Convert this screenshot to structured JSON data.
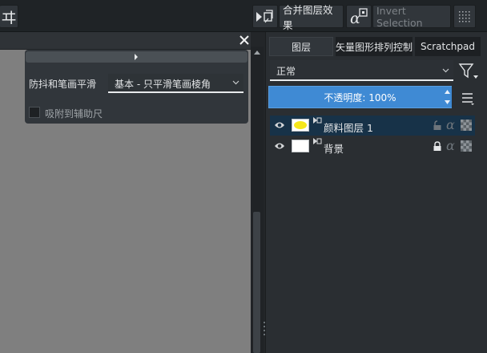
{
  "toolbar": {
    "merge_layer_effects_label": "合并图层效果",
    "invert_selection_label": "Invert Selection",
    "partial_glyph": "ヰ"
  },
  "tool_options": {
    "smoothing_label": "防抖和笔画平滑",
    "smoothing_value": "基本 - 只平滑笔画棱角",
    "snap_assistant_label": "吸附到辅助尺",
    "snap_assistant_checked": false
  },
  "layers_docker": {
    "tabs": [
      {
        "label": "图层",
        "active": true
      },
      {
        "label": "矢量图形排列控制",
        "active": false
      },
      {
        "label": "Scratchpad",
        "active": false
      }
    ],
    "blend_mode": "正常",
    "opacity_label": "不透明度:  100%",
    "opacity_percent": 100,
    "layers": [
      {
        "name": "颜料图层 1",
        "active": true,
        "locked": false,
        "thumbnail": "yellow-blob",
        "visible": true
      },
      {
        "name": "背景",
        "active": false,
        "locked": true,
        "thumbnail": "white",
        "visible": true
      }
    ]
  },
  "colors": {
    "accent_blue": "#3f8ad4",
    "active_layer_bg": "#173248",
    "canvas_gray": "#7f7f7f"
  }
}
